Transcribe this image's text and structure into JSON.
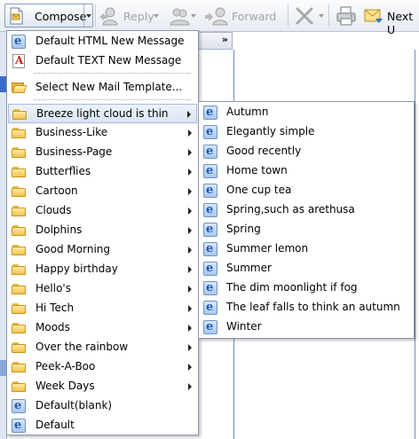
{
  "toolbar": {
    "compose_label": "Compose",
    "reply_label": "Reply",
    "forward_label": "Forward",
    "next_label": "Next U"
  },
  "pane": {
    "collapse_glyph": "»"
  },
  "menu": {
    "items": [
      {
        "label": "Default HTML New Message",
        "icon": "html-message-icon"
      },
      {
        "label": "Default TEXT New Message",
        "icon": "text-message-icon"
      },
      {
        "label": "Select New Mail Template...",
        "icon": "open-folder-icon"
      },
      {
        "label": "Breeze light cloud is thin",
        "icon": "folder-icon",
        "submenu": true,
        "highlighted": true
      },
      {
        "label": "Business-Like",
        "icon": "folder-icon",
        "submenu": true
      },
      {
        "label": "Business-Page",
        "icon": "folder-icon",
        "submenu": true
      },
      {
        "label": "Butterflies",
        "icon": "folder-icon",
        "submenu": true
      },
      {
        "label": "Cartoon",
        "icon": "folder-icon",
        "submenu": true
      },
      {
        "label": "Clouds",
        "icon": "folder-icon",
        "submenu": true
      },
      {
        "label": "Dolphins",
        "icon": "folder-icon",
        "submenu": true
      },
      {
        "label": "Good Morning",
        "icon": "folder-icon",
        "submenu": true
      },
      {
        "label": "Happy birthday",
        "icon": "folder-icon",
        "submenu": true
      },
      {
        "label": "Hello's",
        "icon": "folder-icon",
        "submenu": true
      },
      {
        "label": "Hi Tech",
        "icon": "folder-icon",
        "submenu": true
      },
      {
        "label": "Moods",
        "icon": "folder-icon",
        "submenu": true
      },
      {
        "label": "Over the rainbow",
        "icon": "folder-icon",
        "submenu": true
      },
      {
        "label": "Peek-A-Boo",
        "icon": "folder-icon",
        "submenu": true
      },
      {
        "label": "Week Days",
        "icon": "folder-icon",
        "submenu": true
      },
      {
        "label": "Default(blank)",
        "icon": "html-template-icon"
      },
      {
        "label": "Default",
        "icon": "html-template-icon"
      }
    ]
  },
  "submenu": {
    "items": [
      "Autumn",
      "Elegantly simple",
      "Good recently",
      "Home town",
      "One cup tea",
      "Spring,such as arethusa",
      "Spring",
      "Summer lemon",
      "Summer",
      "The dim moonlight if fog",
      "The leaf falls to think an autumn",
      "Winter"
    ]
  }
}
